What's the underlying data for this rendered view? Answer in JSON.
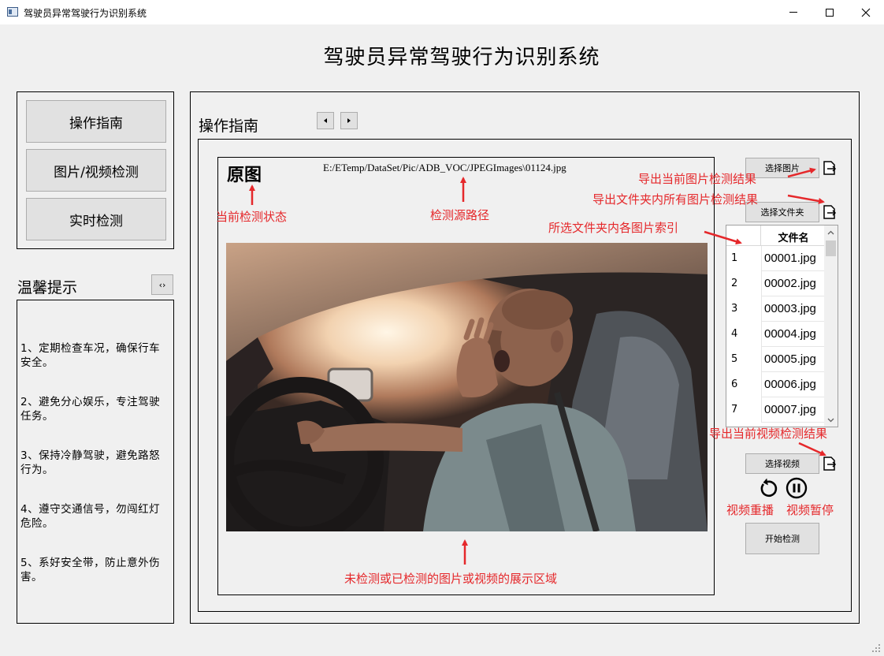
{
  "window": {
    "title": "驾驶员异常驾驶行为识别系统",
    "icon": "app-window-icon"
  },
  "header": {
    "title": "驾驶员异常驾驶行为识别系统"
  },
  "nav": {
    "buttons": [
      {
        "label": "操作指南"
      },
      {
        "label": "图片/视频检测"
      },
      {
        "label": "实时检测"
      }
    ]
  },
  "tips": {
    "title": "温馨提示",
    "toggle_label": "‹›",
    "items": [
      "1、定期检查车况，确保行车安全。",
      "2、避免分心娱乐，专注驾驶任务。",
      "3、保持冷静驾驶，避免路怒行为。",
      "4、遵守交通信号，勿闯红灯危险。",
      "5、系好安全带，防止意外伤害。"
    ]
  },
  "main": {
    "section_title": "操作指南",
    "status_label": "原图",
    "source_path": "E:/ETemp/DataSet/Pic/ADB_VOC/JPEGImages\\01124.jpg",
    "image_icon": "driver-yawning-photo"
  },
  "controls": {
    "select_image": "选择图片",
    "select_folder": "选择文件夹",
    "select_video": "选择视频",
    "start_detect": "开始检测",
    "export_icon": "export-icon",
    "replay_icon": "replay-icon",
    "pause_icon": "pause-icon"
  },
  "file_table": {
    "header": "文件名",
    "rows": [
      {
        "index": "1",
        "name": "00001.jpg"
      },
      {
        "index": "2",
        "name": "00002.jpg"
      },
      {
        "index": "3",
        "name": "00003.jpg"
      },
      {
        "index": "4",
        "name": "00004.jpg"
      },
      {
        "index": "5",
        "name": "00005.jpg"
      },
      {
        "index": "6",
        "name": "00006.jpg"
      },
      {
        "index": "7",
        "name": "00007.jpg"
      }
    ]
  },
  "annotations": {
    "status": "当前检测状态",
    "source": "检测源路径",
    "export_image": "导出当前图片检测结果",
    "export_folder": "导出文件夹内所有图片检测结果",
    "folder_index": "所选文件夹内各图片索引",
    "export_video": "导出当前视频检测结果",
    "replay": "视频重播",
    "pause": "视频暂停",
    "display_area": "未检测或已检测的图片或视频的展示区域",
    "color": "#e5282b"
  }
}
